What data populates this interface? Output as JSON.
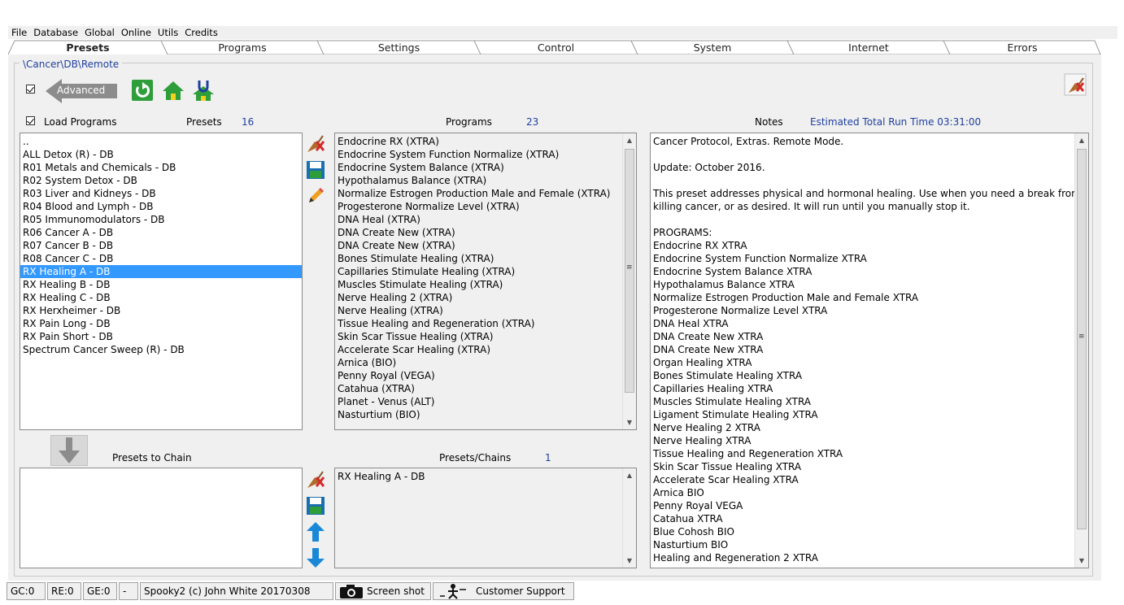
{
  "menu": [
    "File",
    "Database",
    "Global",
    "Online",
    "Utils",
    "Credits"
  ],
  "tabs": [
    "Presets",
    "Programs",
    "Settings",
    "Control",
    "System",
    "Internet",
    "Errors"
  ],
  "active_tab": 0,
  "path": "\\Cancer\\DB\\Remote",
  "advanced_label": "Advanced",
  "load_programs_label": "Load Programs",
  "presets_header": {
    "label": "Presets",
    "count": "16"
  },
  "programs_header": {
    "label": "Programs",
    "count": "23"
  },
  "notes_header": {
    "label": "Notes",
    "runtime": "Estimated Total Run Time 03:31:00"
  },
  "presets": [
    "..",
    "ALL Detox (R) - DB",
    "R01 Metals and Chemicals - DB",
    "R02 System Detox - DB",
    "R03 Liver and Kidneys - DB",
    "R04 Blood and Lymph - DB",
    "R05 Immunomodulators - DB",
    "R06 Cancer A - DB",
    "R07 Cancer B - DB",
    "R08 Cancer C - DB",
    "RX Healing A - DB",
    "RX Healing B - DB",
    "RX Healing C - DB",
    "RX Herxheimer - DB",
    "RX Pain Long - DB",
    "RX Pain Short - DB",
    "Spectrum Cancer Sweep (R) - DB"
  ],
  "selected_preset_index": 10,
  "programs": [
    "Endocrine RX (XTRA)",
    "Endocrine System Function Normalize (XTRA)",
    "Endocrine System Balance (XTRA)",
    "Hypothalamus Balance (XTRA)",
    "Normalize Estrogen Production Male and Female (XTRA)",
    "Progesterone Normalize Level (XTRA)",
    "DNA Heal (XTRA)",
    "DNA Create New (XTRA)",
    "DNA Create New (XTRA)",
    "Bones Stimulate Healing (XTRA)",
    "Capillaries Stimulate Healing (XTRA)",
    "Muscles Stimulate Healing (XTRA)",
    "Nerve Healing 2 (XTRA)",
    "Nerve Healing (XTRA)",
    "Tissue Healing and Regeneration (XTRA)",
    "Skin Scar Tissue Healing (XTRA)",
    "Accelerate Scar Healing (XTRA)",
    "Arnica (BIO)",
    "Penny Royal (VEGA)",
    "Catahua (XTRA)",
    "Planet - Venus (ALT)",
    "Nasturtium (BIO)"
  ],
  "notes": [
    "Cancer Protocol, Extras. Remote Mode.",
    "",
    "Update: October 2016.",
    "",
    "This preset addresses physical and hormonal healing. Use when you need a break from",
    "killing cancer, or as desired. It will run until you manually stop it.",
    "",
    "PROGRAMS:",
    "Endocrine RX XTRA",
    "Endocrine System Function Normalize XTRA",
    "Endocrine System Balance XTRA",
    "Hypothalamus Balance XTRA",
    "Normalize Estrogen Production Male and Female XTRA",
    "Progesterone Normalize Level XTRA",
    "DNA Heal XTRA",
    "DNA Create New XTRA",
    "DNA Create New XTRA",
    "Organ Healing XTRA",
    "Bones Stimulate Healing XTRA",
    "Capillaries Healing XTRA",
    "Muscles Stimulate Healing XTRA",
    "Ligament Stimulate Healing XTRA",
    "Nerve Healing 2 XTRA",
    "Nerve Healing XTRA",
    "Tissue Healing and Regeneration XTRA",
    "Skin Scar Tissue Healing XTRA",
    "Accelerate Scar Healing XTRA",
    "Arnica BIO",
    "Penny Royal VEGA",
    "Catahua XTRA",
    "Blue Cohosh BIO",
    "Nasturtium BIO",
    "Healing and Regeneration 2 XTRA"
  ],
  "presets_to_chain_label": "Presets to Chain",
  "presets_chains_header": {
    "label": "Presets/Chains",
    "count": "1"
  },
  "presets_chains": [
    "RX Healing A - DB"
  ],
  "status": {
    "gc": "GC:0",
    "re": "RE:0",
    "ge": "GE:0",
    "dash": "-",
    "version": "Spooky2 (c) John White 20170308",
    "screenshot": "Screen shot",
    "support": "Customer Support"
  },
  "colors": {
    "accent_green": "#2e9e3a",
    "selection_blue": "#3399ff",
    "label_blue": "#1f3fa0"
  }
}
